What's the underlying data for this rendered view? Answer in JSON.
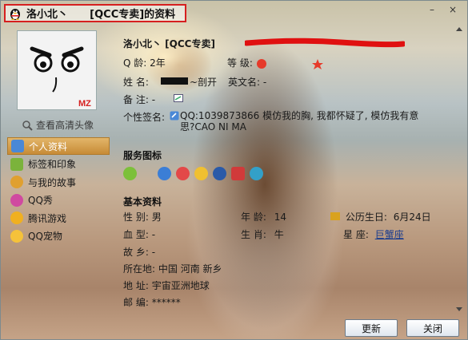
{
  "title": {
    "text": "洛小北丶      [QCC专卖]的资料"
  },
  "window_buttons": {
    "minimize": "–",
    "close": "×"
  },
  "avatar": {
    "link_label": "查看高清头像",
    "sig_text": "MZ"
  },
  "nav": {
    "items": [
      {
        "label": "个人资料",
        "active": true
      },
      {
        "label": "标签和印象"
      },
      {
        "label": "与我的故事"
      },
      {
        "label": "QQ秀"
      },
      {
        "label": "腾讯游戏"
      },
      {
        "label": "QQ宠物"
      }
    ]
  },
  "profile": {
    "name_line": "洛小北丶      [QCC专卖]",
    "age_label": "Q   龄:",
    "age_value": "2年",
    "level_label": "等   级:",
    "name_label": "姓   名:",
    "name_suffix": "~剖开",
    "en_name_label": "英文名:",
    "en_name_value": "-",
    "note_label": "备   注:",
    "note_value": "-",
    "signature_label": "个性签名:",
    "signature_text": "QQ:1039873866  模仿我的胸, 我都怀疑了, 模仿我有意思?CAO NI MA"
  },
  "service": {
    "title": "服务图标"
  },
  "basic": {
    "title": "基本资料",
    "fields": [
      {
        "label": "性   别:",
        "value": "男"
      },
      {
        "label": "年   龄:",
        "value": "14"
      },
      {
        "label": "公历生日:",
        "value": "6月24日"
      },
      {
        "label": "血   型:",
        "value": "-"
      },
      {
        "label": "生   肖:",
        "value": "牛"
      },
      {
        "label": "星     座:",
        "value": "巨蟹座"
      },
      {
        "label": "故   乡:",
        "value": "-"
      },
      {
        "label": "所在地:",
        "value": "中国 河南 新乡"
      },
      {
        "label": "地   址:",
        "value": "宇宙亚洲地球"
      },
      {
        "label": "邮   编:",
        "value": "******"
      }
    ]
  },
  "buttons": {
    "refresh": "更新",
    "close": "关闭"
  },
  "colors": {
    "accent_red": "#d61f1f",
    "nav_active": "#d39a45",
    "link": "#1a3d8f"
  }
}
